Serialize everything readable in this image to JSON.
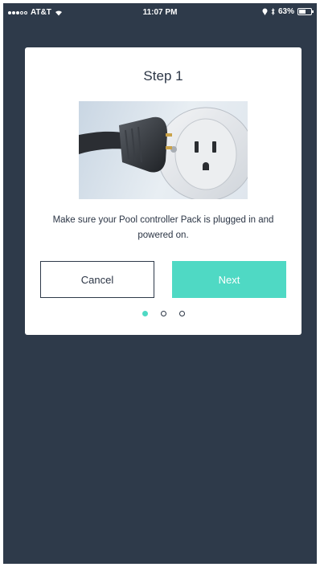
{
  "status_bar": {
    "carrier": "AT&T",
    "time": "11:07 PM",
    "battery": "63%",
    "battery_level": 0.63
  },
  "dialog": {
    "title": "Step 1",
    "message": "Make sure your Pool controller Pack is plugged in and powered on.",
    "cancel_label": "Cancel",
    "next_label": "Next",
    "pagination": {
      "total": 3,
      "current": 1
    }
  },
  "colors": {
    "background": "#2e3a4a",
    "accent": "#4fd9c4",
    "text": "#2b3545"
  },
  "icons": {
    "signal": "signal-dots-icon",
    "wifi": "wifi-icon",
    "location": "location-icon",
    "bluetooth": "bluetooth-icon",
    "battery": "battery-icon"
  }
}
